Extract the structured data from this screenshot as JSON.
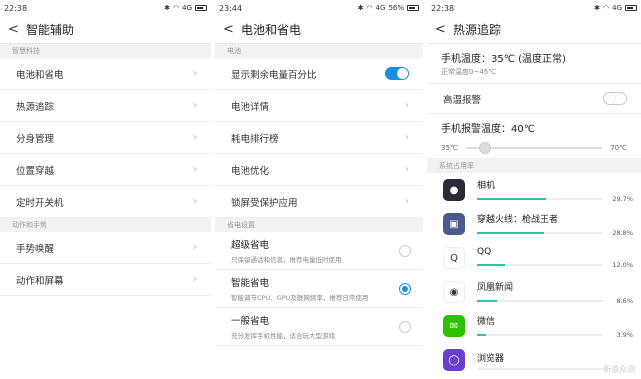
{
  "panel1": {
    "status": {
      "time": "22:38",
      "network": "4G"
    },
    "header": {
      "back": "<",
      "title": "智能辅助"
    },
    "section1": "智慧科技",
    "items1": [
      {
        "label": "电池和省电"
      },
      {
        "label": "热源追踪"
      },
      {
        "label": "分身管理"
      },
      {
        "label": "位置穿越"
      },
      {
        "label": "定时开关机"
      }
    ],
    "section2": "动作和手势",
    "items2": [
      {
        "label": "手势唤醒"
      },
      {
        "label": "动作和屏幕"
      }
    ]
  },
  "panel2": {
    "status": {
      "time": "23:44",
      "network": "4G",
      "battery": "56%"
    },
    "header": {
      "back": "<",
      "title": "电池和省电"
    },
    "section1": "电池",
    "show_percent_label": "显示剩余电量百分比",
    "show_percent_on": true,
    "items": [
      {
        "label": "电池详情"
      },
      {
        "label": "耗电排行榜"
      },
      {
        "label": "电池优化"
      },
      {
        "label": "锁屏受保护应用"
      }
    ],
    "section2": "省电设置",
    "modes": [
      {
        "title": "超级省电",
        "desc": "只保留通话和信息，推荐电量低时使用",
        "selected": false
      },
      {
        "title": "智能省电",
        "desc": "智能调节CPU、GPU及联网频率，推荐日常使用",
        "selected": true
      },
      {
        "title": "一般省电",
        "desc": "充分发挥手机性能，适合玩大型游戏",
        "selected": false
      }
    ]
  },
  "panel3": {
    "status": {
      "time": "22:38",
      "network": "4G"
    },
    "header": {
      "back": "<",
      "title": "热源追踪"
    },
    "phone_temp": "手机温度：35℃ (温度正常)",
    "normal_range": "正常温度0~45℃",
    "high_temp_alarm": "高温报警",
    "high_temp_on": false,
    "alarm_temp": "手机报警温度：40℃",
    "slider_min": "35℃",
    "slider_max": "70℃",
    "slider_value": 0.14,
    "section": "系统占用率",
    "apps": [
      {
        "name": "相机",
        "pct": "29.7%",
        "value": 29.7,
        "color": "#2a2a3a",
        "icon": "camera-app-icon"
      },
      {
        "name": "穿越火线：枪战王者",
        "pct": "28.8%",
        "value": 28.8,
        "color": "#4a5a8a",
        "icon": "game-app-icon"
      },
      {
        "name": "QQ",
        "pct": "12.0%",
        "value": 12.0,
        "color": "#ffffff",
        "icon": "qq-app-icon"
      },
      {
        "name": "凤凰新闻",
        "pct": "8.6%",
        "value": 8.6,
        "color": "#ffffff",
        "icon": "news-app-icon"
      },
      {
        "name": "微信",
        "pct": "3.9%",
        "value": 3.9,
        "color": "#2dc100",
        "icon": "wechat-app-icon"
      },
      {
        "name": "浏览器",
        "pct": "",
        "value": 0,
        "color": "#6a3fd0",
        "icon": "browser-app-icon"
      }
    ],
    "watermark": "新浪众测"
  }
}
